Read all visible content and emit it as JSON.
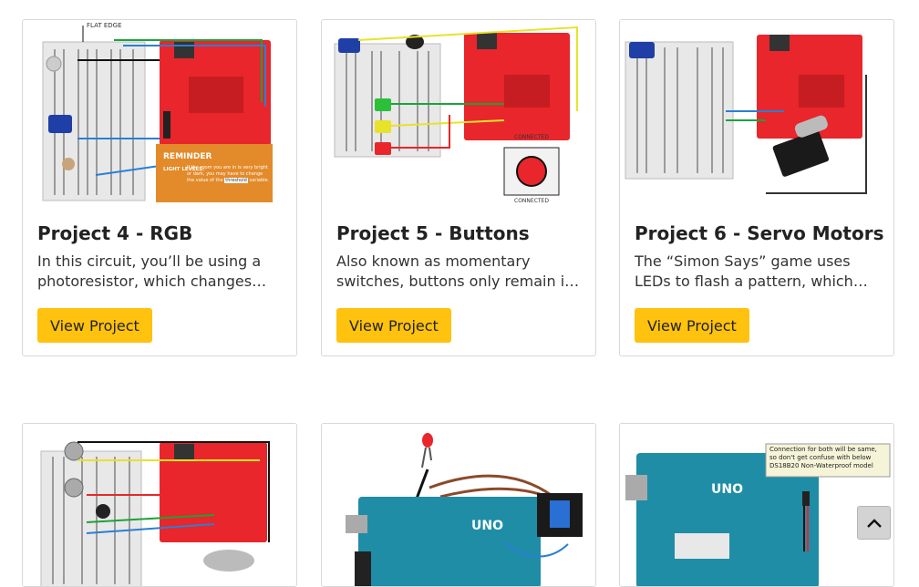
{
  "cards": [
    {
      "title": "Project 4 - RGB",
      "description": "In this circuit, you’ll be using a photoresistor, which changes resistance based on how much light it sees.",
      "button_label": "View Project",
      "diagram": {
        "edge_label": "FLAT EDGE",
        "reminder_title": "REMINDER",
        "reminder_bold": "LIGHT LEVELS:",
        "reminder_text": "If the room you are in is very bright or dark, you may have to change the value of the",
        "reminder_code": "threshold",
        "reminder_tail": "variable."
      }
    },
    {
      "title": "Project 5 - Buttons",
      "description": "Also known as momentary switches, buttons only remain in their on state as long as they’re being actuated.",
      "button_label": "View Project",
      "diagram": {
        "label_top": "CONNECTED",
        "label_bottom": "CONNECTED"
      }
    },
    {
      "title": "Project 6 - Servo Motors",
      "description": "The “Simon Says” game uses LEDs to flash a pattern, which the player must remember.",
      "button_label": "View Project"
    },
    {
      "title": "",
      "description": "",
      "button_label": ""
    },
    {
      "title": "",
      "description": "",
      "button_label": "",
      "diagram": {
        "board_label": "UNO"
      }
    },
    {
      "title": "",
      "description": "",
      "button_label": "",
      "diagram": {
        "board_label": "UNO",
        "note": "Connection for both will be same, so don't get confuse with below DS18B20 Non-Waterproof model"
      }
    }
  ],
  "scroll_top": {
    "icon": "chevron-up-icon"
  },
  "colors": {
    "accent": "#ffc20e",
    "board_red": "#e8262b",
    "arduino_teal": "#1f8da6",
    "reminder_orange": "#e38a2a"
  }
}
